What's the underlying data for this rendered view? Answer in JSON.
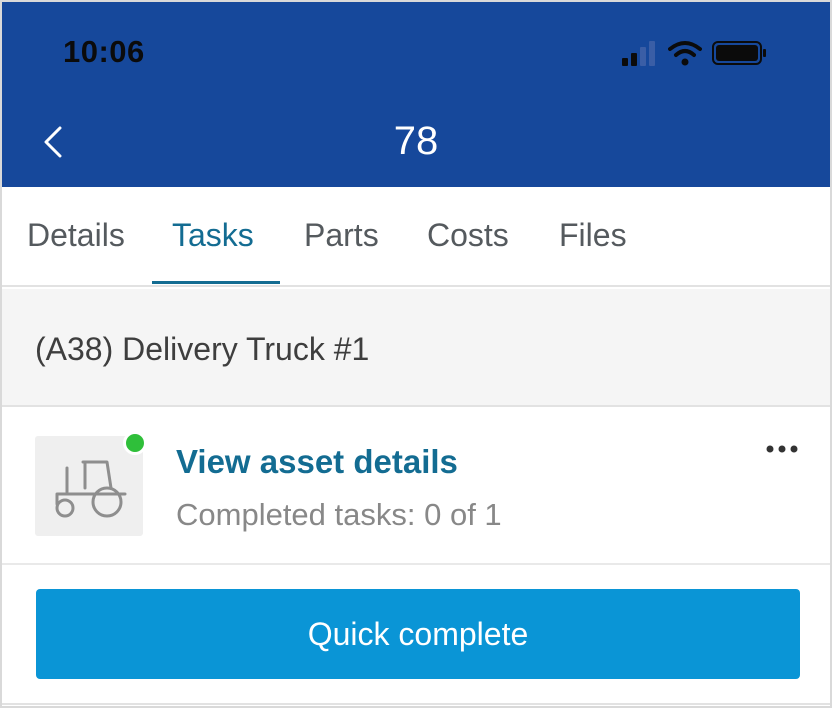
{
  "status_bar": {
    "time": "10:06",
    "icons": [
      "signal-icon",
      "wifi-icon",
      "battery-icon"
    ]
  },
  "nav": {
    "back_icon": "chevron-left-icon",
    "title": "78"
  },
  "tabs": [
    {
      "label": "Details",
      "active": false
    },
    {
      "label": "Tasks",
      "active": true
    },
    {
      "label": "Parts",
      "active": false
    },
    {
      "label": "Costs",
      "active": false
    },
    {
      "label": "Files",
      "active": false
    }
  ],
  "asset": {
    "name": "(A38) Delivery Truck #1",
    "thumbnail_icon": "tractor-icon",
    "status_color": "#2fbf3a",
    "link_label": "View asset details",
    "meta": "Completed tasks: 0 of 1",
    "more_icon": "more-horizontal-icon"
  },
  "actions": {
    "quick_complete_label": "Quick complete"
  },
  "colors": {
    "header": "#16489b",
    "accent": "#136c92",
    "button": "#0a95d6"
  }
}
